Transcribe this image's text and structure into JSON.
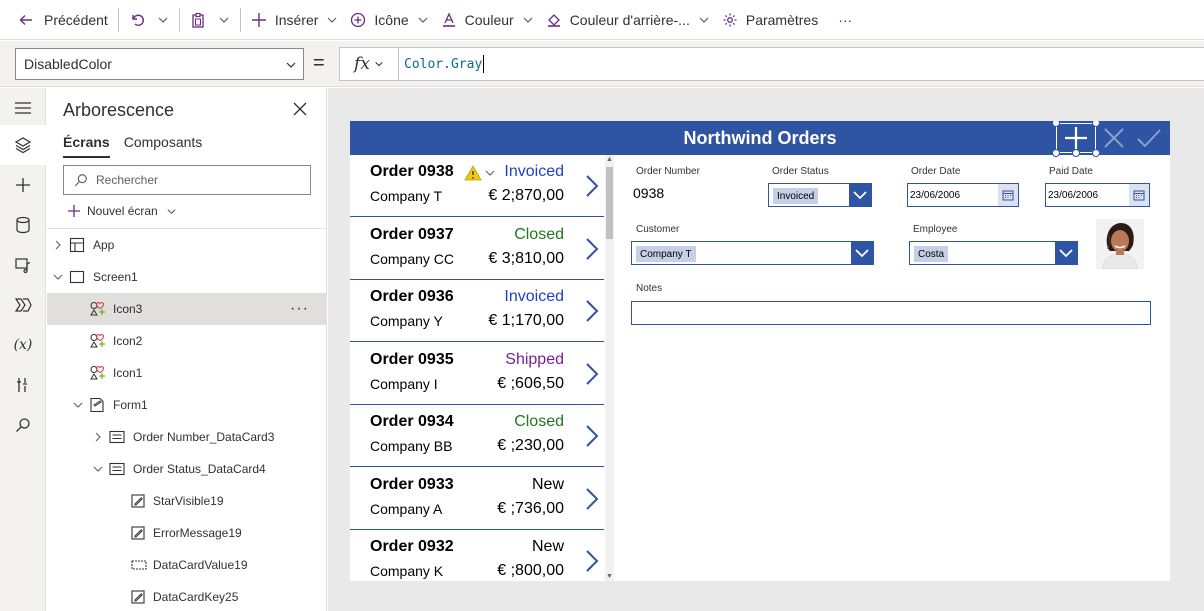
{
  "toolbar": {
    "back_label": "Précédent",
    "insert_label": "Insérer",
    "icon_label": "Icône",
    "color_label": "Couleur",
    "bgcolor_label": "Couleur d'arrière-...",
    "settings_label": "Paramètres",
    "more_label": "···"
  },
  "formula_bar": {
    "property": "DisabledColor",
    "equals": "=",
    "fx_label": "fx",
    "formula": "Color.Gray"
  },
  "tree": {
    "title": "Arborescence",
    "tabs": [
      "Écrans",
      "Composants"
    ],
    "search_placeholder": "Rechercher",
    "new_screen_label": "Nouvel écran",
    "items": [
      {
        "label": "App",
        "icon": "app-icon"
      },
      {
        "label": "Screen1",
        "icon": "screen-icon"
      },
      {
        "label": "Icon3",
        "icon": "icon-control-icon",
        "selected": true
      },
      {
        "label": "Icon2",
        "icon": "icon-control-icon"
      },
      {
        "label": "Icon1",
        "icon": "icon-control-icon"
      },
      {
        "label": "Form1",
        "icon": "form-icon"
      },
      {
        "label": "Order Number_DataCard3",
        "icon": "datacard-icon"
      },
      {
        "label": "Order Status_DataCard4",
        "icon": "datacard-icon"
      },
      {
        "label": "StarVisible19",
        "icon": "label-icon"
      },
      {
        "label": "ErrorMessage19",
        "icon": "label-icon"
      },
      {
        "label": "DataCardValue19",
        "icon": "dropdown-icon"
      },
      {
        "label": "DataCardKey25",
        "icon": "label-icon"
      }
    ],
    "more_label": "···"
  },
  "app": {
    "title": "Northwind Orders",
    "orders": [
      {
        "number": "Order 0938",
        "company": "Company T",
        "status": "Invoiced",
        "amount": "€ 2;870,00",
        "status_color": "#1f3fcb",
        "warning": true
      },
      {
        "number": "Order 0937",
        "company": "Company CC",
        "status": "Closed",
        "amount": "€ 3;810,00",
        "status_color": "#1e7a1e"
      },
      {
        "number": "Order 0936",
        "company": "Company Y",
        "status": "Invoiced",
        "amount": "€ 1;170,00",
        "status_color": "#1f3fcb"
      },
      {
        "number": "Order 0935",
        "company": "Company I",
        "status": "Shipped",
        "amount": "€ ;606,50",
        "status_color": "#7b1f99"
      },
      {
        "number": "Order 0934",
        "company": "Company BB",
        "status": "Closed",
        "amount": "€ ;230,00",
        "status_color": "#1e7a1e"
      },
      {
        "number": "Order 0933",
        "company": "Company A",
        "status": "New",
        "amount": "€ ;736,00",
        "status_color": "#000000"
      },
      {
        "number": "Order 0932",
        "company": "Company K",
        "status": "New",
        "amount": "€ ;800,00",
        "status_color": "#000000"
      }
    ],
    "form": {
      "order_number_label": "Order Number",
      "order_number_value": "0938",
      "order_status_label": "Order Status",
      "order_status_value": "Invoiced",
      "order_date_label": "Order Date",
      "order_date_value": "23/06/2006",
      "paid_date_label": "Paid Date",
      "paid_date_value": "23/06/2006",
      "customer_label": "Customer",
      "customer_value": "Company T",
      "employee_label": "Employee",
      "employee_value": "Costa",
      "notes_label": "Notes",
      "notes_value": ""
    }
  },
  "colors": {
    "accent": "#6b2b86",
    "app_header": "#2f54a4",
    "canvas_bg": "#e9e9e9"
  }
}
